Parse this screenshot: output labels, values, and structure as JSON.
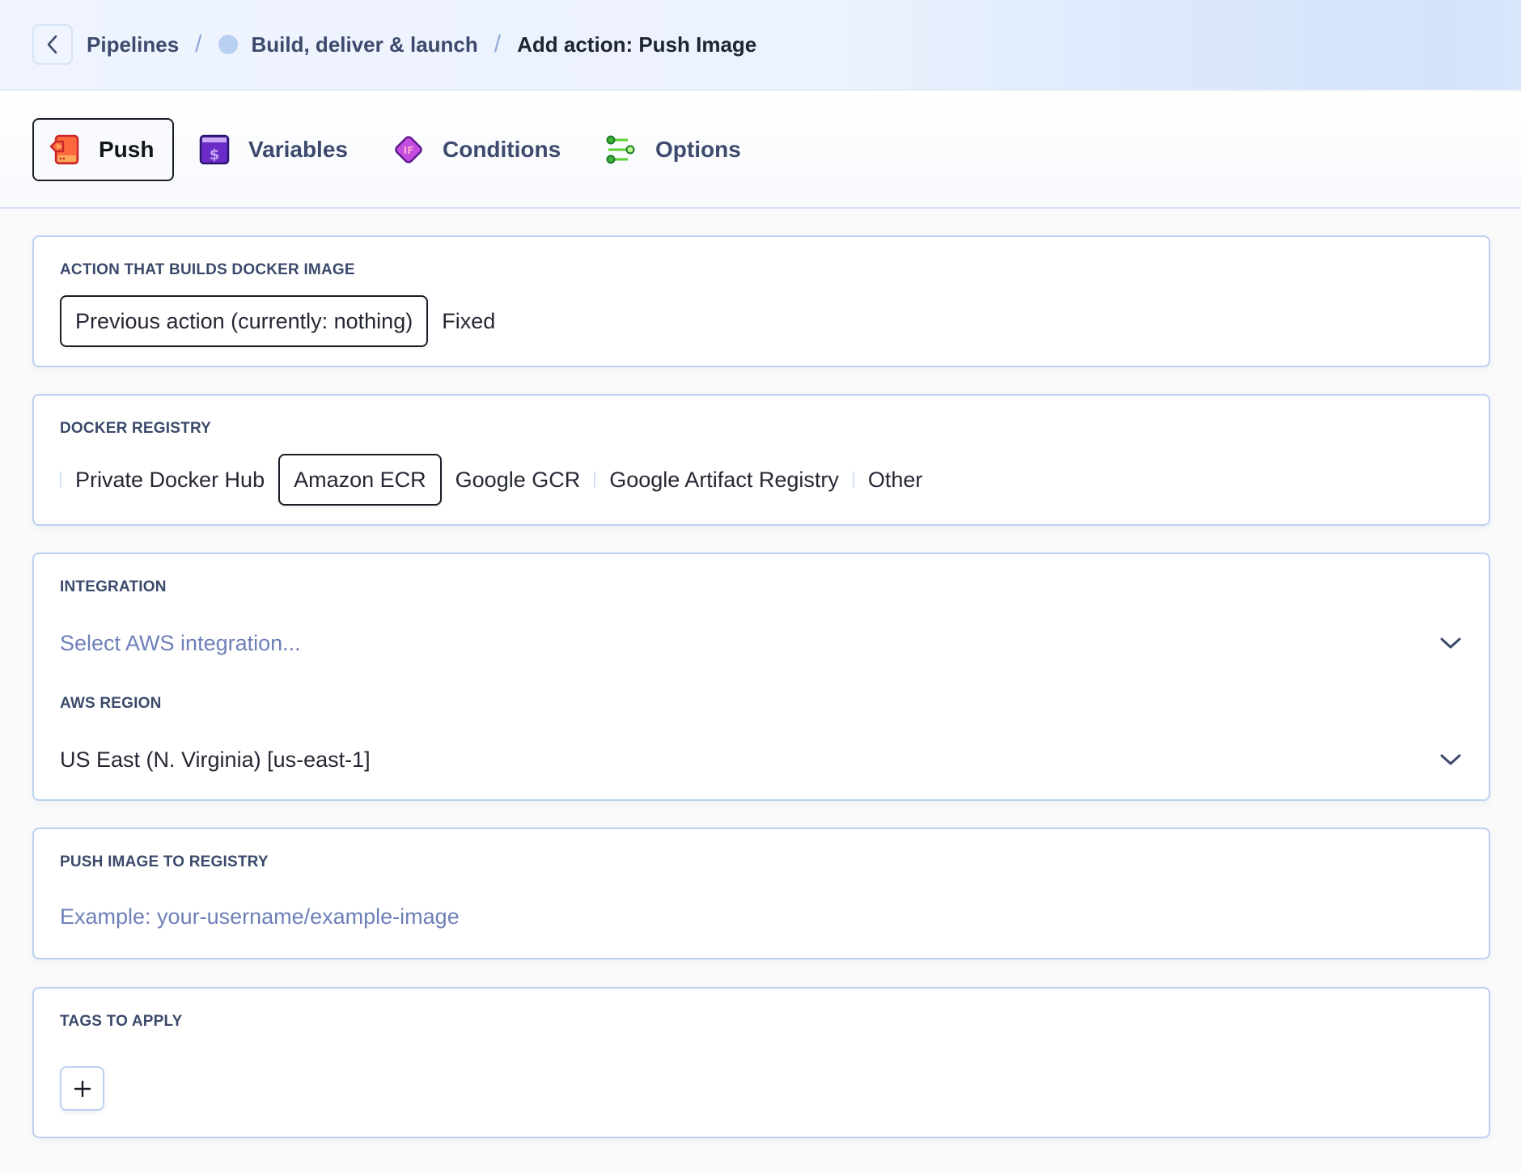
{
  "header": {
    "back_icon": "chevron-left-icon",
    "breadcrumb": [
      {
        "label": "Pipelines"
      },
      {
        "label": "Build, deliver & launch",
        "status_dot_color": "#b9cff2"
      },
      {
        "label": "Add action: Push Image"
      }
    ],
    "separator": "/"
  },
  "tabs": [
    {
      "label": "Push",
      "icon": "push-icon",
      "active": true
    },
    {
      "label": "Variables",
      "icon": "variables-icon",
      "active": false
    },
    {
      "label": "Conditions",
      "icon": "conditions-if-icon",
      "active": false
    },
    {
      "label": "Options",
      "icon": "options-sliders-icon",
      "active": false
    }
  ],
  "sections": {
    "build_action": {
      "label": "ACTION THAT BUILDS DOCKER IMAGE",
      "options": [
        "Previous action (currently: nothing)",
        "Fixed"
      ],
      "selected": "Previous action (currently: nothing)"
    },
    "registry": {
      "label": "DOCKER REGISTRY",
      "options": [
        "Private Docker Hub",
        "Amazon ECR",
        "Google GCR",
        "Google Artifact Registry",
        "Other"
      ],
      "selected": "Amazon ECR"
    },
    "integration": {
      "label": "INTEGRATION",
      "placeholder": "Select AWS integration..."
    },
    "region": {
      "label": "AWS REGION",
      "value": "US East (N. Virginia) [us-east-1]"
    },
    "push_to": {
      "label": "PUSH IMAGE TO REGISTRY",
      "placeholder": "Example: your-username/example-image"
    },
    "tags": {
      "label": "TAGS TO APPLY",
      "add_icon": "plus-icon"
    }
  },
  "colors": {
    "accent_border": "#bcd1f0",
    "label_text": "#3b4a6b",
    "placeholder_text": "#6f80b8"
  }
}
